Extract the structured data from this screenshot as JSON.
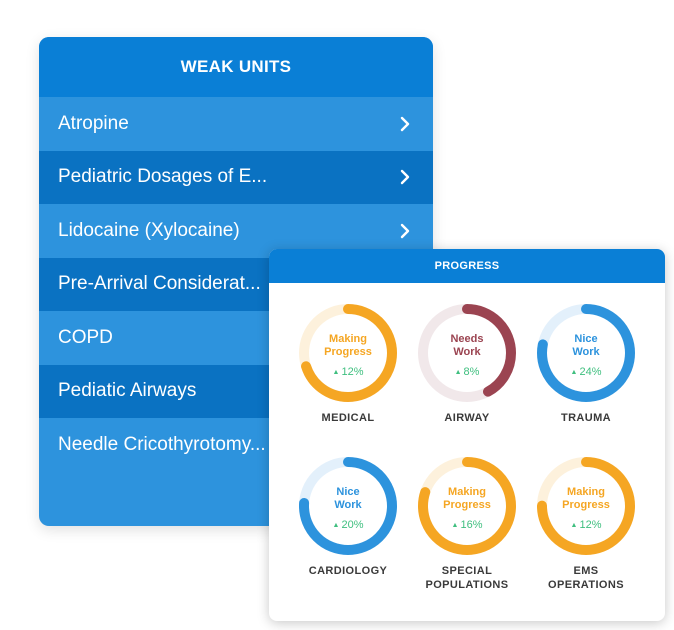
{
  "weak_units": {
    "title": "WEAK UNITS",
    "items": [
      {
        "label": "Atropine",
        "chevron": true
      },
      {
        "label": "Pediatric Dosages of E...",
        "chevron": true
      },
      {
        "label": "Lidocaine (Xylocaine)",
        "chevron": true
      },
      {
        "label": "Pre-Arrival Considerat...",
        "chevron": false
      },
      {
        "label": "COPD",
        "chevron": false
      },
      {
        "label": "Pediatic Airways",
        "chevron": false
      },
      {
        "label": "Needle Cricothyrotomy...",
        "chevron": false
      }
    ]
  },
  "progress": {
    "title": "PROGRESS",
    "gauges": [
      {
        "status_line1": "Making",
        "status_line2": "Progress",
        "change": "12%",
        "category_line1": "MEDICAL",
        "category_line2": "",
        "color": "#f5a623",
        "track": "#fdf1dc",
        "fill": 0.7
      },
      {
        "status_line1": "Needs",
        "status_line2": "Work",
        "change": "8%",
        "category_line1": "AIRWAY",
        "category_line2": "",
        "color": "#9b4451",
        "track": "#f1e8ea",
        "fill": 0.42
      },
      {
        "status_line1": "Nice",
        "status_line2": "Work",
        "change": "24%",
        "category_line1": "TRAUMA",
        "category_line2": "",
        "color": "#2d93dd",
        "track": "#e3f0fb",
        "fill": 0.78
      },
      {
        "status_line1": "Nice",
        "status_line2": "Work",
        "change": "20%",
        "category_line1": "CARDIOLOGY",
        "category_line2": "",
        "color": "#2d93dd",
        "track": "#e3f0fb",
        "fill": 0.76
      },
      {
        "status_line1": "Making",
        "status_line2": "Progress",
        "change": "16%",
        "category_line1": "SPECIAL",
        "category_line2": "POPULATIONS",
        "color": "#f5a623",
        "track": "#fdf1dc",
        "fill": 0.8
      },
      {
        "status_line1": "Making",
        "status_line2": "Progress",
        "change": "12%",
        "category_line1": "EMS",
        "category_line2": "OPERATIONS",
        "color": "#f5a623",
        "track": "#fdf1dc",
        "fill": 0.75
      }
    ]
  },
  "icons": {
    "chevron": "chevron-right-icon",
    "up_arrow": "up-triangle-icon"
  }
}
